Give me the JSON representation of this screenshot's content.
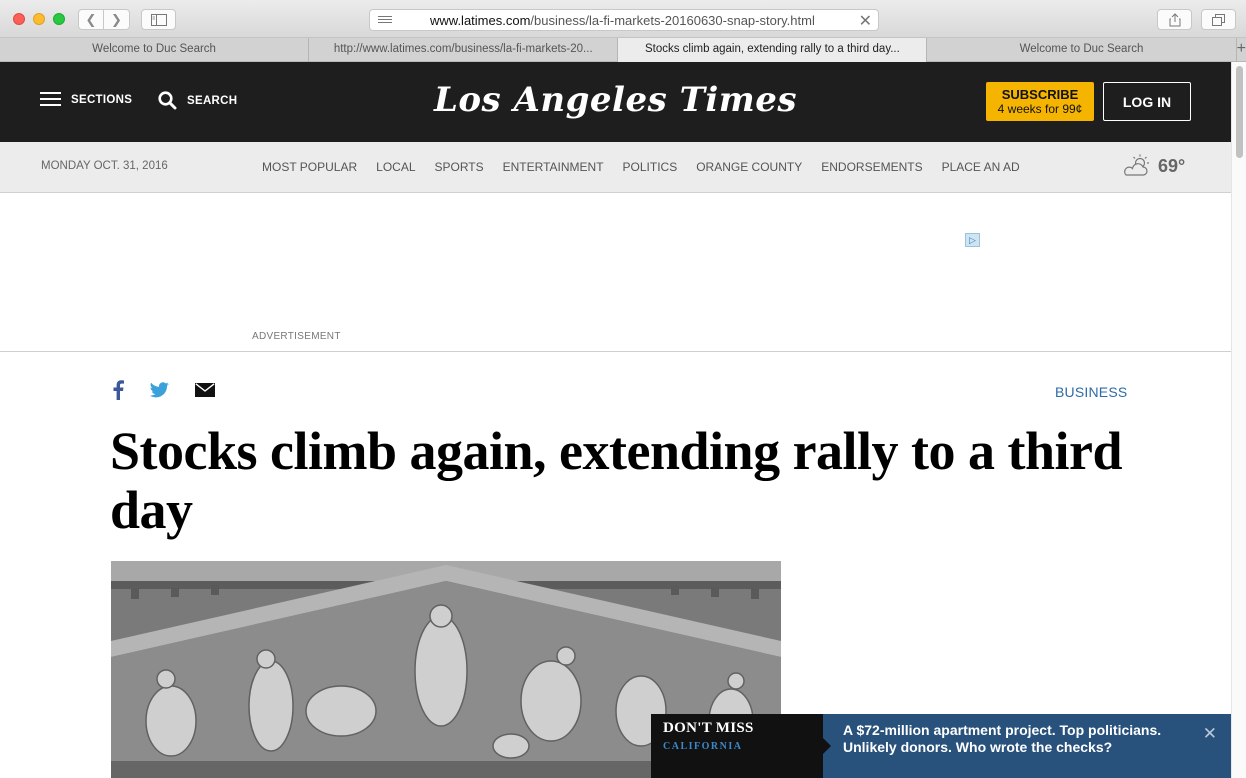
{
  "browser": {
    "url_host": "www.latimes.com",
    "url_path": "/business/la-fi-markets-20160630-snap-story.html",
    "tabs": [
      {
        "label": "Welcome to Duc Search"
      },
      {
        "label": "http://www.latimes.com/business/la-fi-markets-20..."
      },
      {
        "label": "Stocks climb again, extending rally to a third day..."
      },
      {
        "label": "Welcome to Duc Search"
      }
    ]
  },
  "masthead": {
    "sections_label": "SECTIONS",
    "search_label": "SEARCH",
    "logo_text": "Los Angeles Times",
    "subscribe_label": "SUBSCRIBE",
    "subscribe_offer": "4 weeks for 99¢",
    "login_label": "LOG IN"
  },
  "subnav": {
    "date": "MONDAY OCT. 31, 2016",
    "links": [
      "MOST POPULAR",
      "LOCAL",
      "SPORTS",
      "ENTERTAINMENT",
      "POLITICS",
      "ORANGE COUNTY",
      "ENDORSEMENTS",
      "PLACE AN AD"
    ],
    "temperature": "69°",
    "weather_icon": "partly-cloudy-icon"
  },
  "ad": {
    "label": "ADVERTISEMENT"
  },
  "article": {
    "section": "BUSINESS",
    "headline": "Stocks climb again, extending rally to a third day"
  },
  "dont_miss": {
    "title": "DON'T MISS",
    "category": "CALIFORNIA",
    "text": "A $72-million apartment project. Top politicians. Unlikely donors. Who wrote the checks?"
  },
  "colors": {
    "masthead_bg": "#1e1e1e",
    "subscribe_bg": "#f4b400",
    "section_link": "#2e6aa8",
    "dont_miss_bg": "#28527c"
  }
}
